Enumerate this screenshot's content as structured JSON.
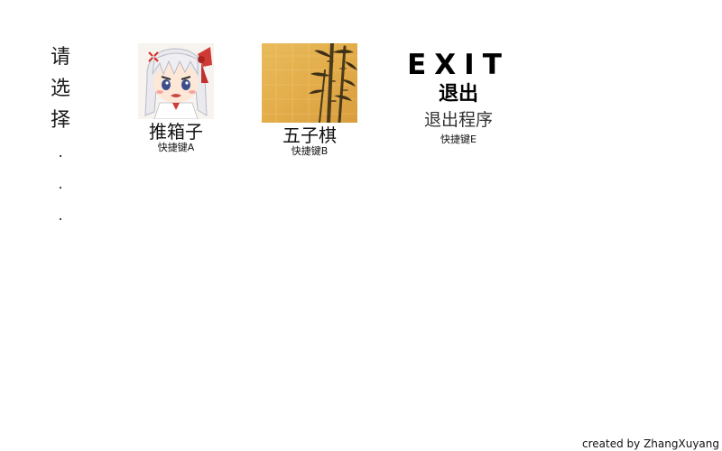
{
  "prompt": {
    "chars": [
      "请",
      "选",
      "择"
    ],
    "dots": [
      ".",
      ".",
      "."
    ]
  },
  "options": {
    "sokoban": {
      "title": "推箱子",
      "hotkey": "快捷键A",
      "icon": "anime-girl-avatar-icon"
    },
    "gomoku": {
      "title": "五子棋",
      "hotkey": "快捷键B",
      "icon": "bamboo-paper-icon"
    },
    "exit": {
      "title_en": "EXIT",
      "title_cn": "退出",
      "desc": "退出程序",
      "hotkey": "快捷键E"
    }
  },
  "footer": {
    "credit": "created by ZhangXuyang"
  },
  "colors": {
    "background": "#ffffff",
    "text": "#111111",
    "gold": "#e2ae4c",
    "bamboo": "#4a3a1c"
  }
}
